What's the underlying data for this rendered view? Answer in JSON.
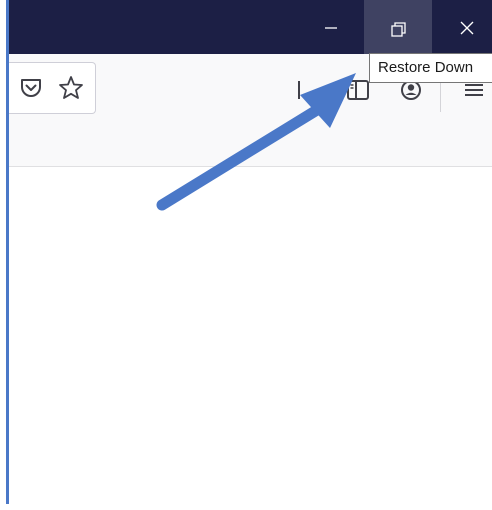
{
  "window_controls": {
    "minimize_icon": "minimize-icon",
    "restore_icon": "restore-down-icon",
    "close_icon": "close-icon"
  },
  "tooltip": {
    "text": "Restore Down"
  },
  "toolbar": {
    "icons": [
      "pocket-icon",
      "bookmark-star-icon",
      "library-icon",
      "sidebar-icon",
      "account-icon",
      "menu-icon"
    ]
  },
  "annotation": {
    "arrow_color": "#4a78c8"
  },
  "colors": {
    "titlebar": "#1c1f45",
    "restore_hover": "#3f4262",
    "toolbar": "#f9f9fa",
    "accent_border": "#4a78c8"
  }
}
